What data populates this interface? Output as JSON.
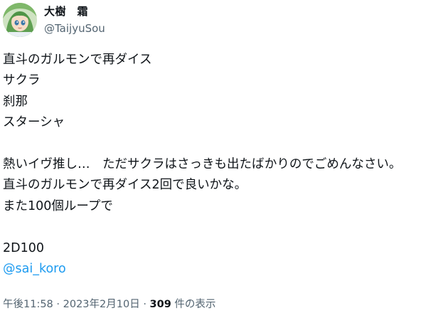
{
  "author": {
    "display_name": "大樹　霜",
    "handle": "@TaijyuSou",
    "avatar_icon": "anime-girl-avatar"
  },
  "tweet": {
    "lines": [
      "直斗のガルモンで再ダイス",
      "サクラ",
      "刹那",
      "スターシャ",
      "",
      "熱いイヴ推し…　ただサクラはさっきも出たばかりのでごめんなさい。",
      "直斗のガルモンで再ダイス2回で良いかな。",
      "また100個ループで",
      "",
      "2D100"
    ],
    "mention": "@sai_koro"
  },
  "meta": {
    "time": "午後11:58",
    "separator": "·",
    "date": "2023年2月10日",
    "views_count": "309",
    "views_label": "件の表示"
  },
  "colors": {
    "text": "#0f1419",
    "secondary": "#536471",
    "link": "#1d9bf0",
    "background": "#ffffff"
  }
}
